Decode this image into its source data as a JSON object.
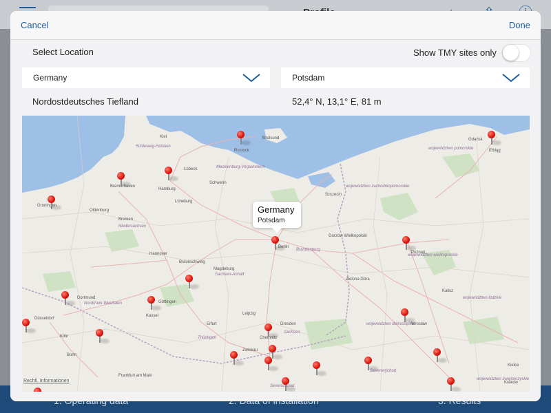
{
  "background": {
    "title": "Profile",
    "tabs": [
      "1. Operating data",
      "2. Data of installation",
      "3. Results"
    ]
  },
  "navbar": {
    "cancel_label": "Cancel",
    "done_label": "Done"
  },
  "location": {
    "select_label": "Select Location",
    "tmy_label": "Show TMY sites only",
    "tmy_enabled": false,
    "country_value": "Germany",
    "city_value": "Potsdam",
    "region": "Nordostdeutsches Tiefland",
    "coordinates": "52,4° N, 13,1° E, 81 m"
  },
  "map": {
    "callout": {
      "title": "Germany",
      "subtitle": "Potsdam"
    },
    "legal_label": "Rechtl. Informationen",
    "city_labels": [
      "Hamburg",
      "Bremen",
      "Bremerhaven",
      "Hannover",
      "Braunschweig",
      "Magdeburg",
      "Berlin",
      "Leipzig",
      "Dresden",
      "Göttingen",
      "Kassel",
      "Düsseldorf",
      "Köln",
      "Bonn",
      "Frankfurt am Main",
      "Szczecin",
      "Gdańsk",
      "Elbląg",
      "Poznań",
      "Wrocław",
      "Kraków",
      "Lübeck",
      "Schwerin",
      "Rostock",
      "Erfurt",
      "Zwickau",
      "Chemnitz",
      "Gorzów Wielkopolski",
      "Zielona Góra",
      "Kalisz",
      "Kielce",
      "Oldenburg",
      "Groningen",
      "Dortmund",
      "Kiel",
      "Stralsund",
      "Lüneburg"
    ],
    "region_labels": [
      "Schleswig-Holstein",
      "Mecklenburg-Vorpommern",
      "Niedersachsen",
      "Sachsen-Anhalt",
      "Brandenburg",
      "Sachsen",
      "Thüringen",
      "Nordrhein-Westfalen",
      "województwo pomorskie",
      "województwo zachodniopomorskie",
      "województwo wielkopolskie",
      "województwo dolnośląskie",
      "województwo łódzkie",
      "województwo świętokrzyskie",
      "Severozápad",
      "Severovýchod"
    ]
  },
  "colors": {
    "accent": "#1d5d9b",
    "water": "#9fc0e6",
    "pin": "#d8140c"
  }
}
